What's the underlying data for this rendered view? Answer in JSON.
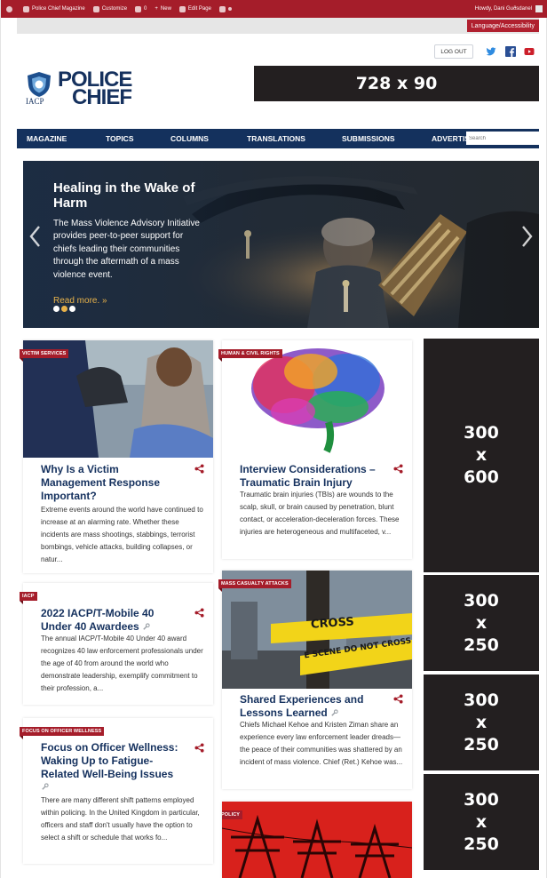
{
  "admin_bar": {
    "site_name": "Police Chief Magazine",
    "customize": "Customize",
    "comments": "0",
    "new": "New",
    "edit_page": "Edit Page",
    "howdy": "Howdy, Dani Guðsdanel"
  },
  "top_bar": {
    "language_label": "Language/Accessibility"
  },
  "header": {
    "logout_label": "LOG OUT",
    "logo_line1": "POLICE",
    "logo_line2": "CHIEF",
    "logo_org": "IACP",
    "leaderboard_ad": "728 x 90"
  },
  "nav": {
    "items": [
      "MAGAZINE",
      "TOPICS",
      "COLUMNS",
      "TRANSLATIONS",
      "SUBMISSIONS",
      "ADVERTIS"
    ],
    "search_placeholder": "Search"
  },
  "slider": {
    "title": "Healing in the Wake of Harm",
    "text": "The Mass Violence Advisory Initiative provides peer-to-peer support for chiefs leading their communities through the aftermath of a mass violence event.",
    "read_more": "Read more. »",
    "dots": 3,
    "active_dot": 1
  },
  "ads": {
    "large": [
      "300",
      "x",
      "600"
    ],
    "medium": [
      "300",
      "x",
      "250"
    ]
  },
  "cards": [
    {
      "tag": "VICTIM SERVICES",
      "title": "Why Is a Victim Management Response Important?",
      "excerpt": "Extreme events around the world have continued to increase at an alarming rate. Whether these incidents are mass shootings, stabbings, terrorist bombings, vehicle attacks, building collapses, or natur..."
    },
    {
      "tag": "HUMAN & CIVIL RIGHTS",
      "title": "Interview Considerations – Traumatic Brain Injury",
      "excerpt": "Traumatic brain injuries (TBIs) are wounds to the scalp, skull, or brain caused by penetration, blunt contact, or acceleration-deceleration forces. These injuries are heterogeneous and multifaceted, v..."
    },
    {
      "tag": "IACP",
      "title": "2022 IACP/T-Mobile 40 Under 40 Awardees",
      "excerpt": "The annual IACP/T-Mobile 40 Under 40 award recognizes 40 law enforcement professionals under the age of 40 from around the world who demonstrate leadership, exemplify commitment to their profession, a..."
    },
    {
      "tag": "MASS CASUALTY ATTACKS",
      "title": "Shared Experiences and Lessons Learned",
      "excerpt": "Chiefs Michael Kehoe and Kristen Ziman share an experience every law enforcement leader dreads—the peace of their communities was shattered by an incident of mass violence. Chief (Ret.) Kehoe was...",
      "tape_text_1": "CROSS",
      "tape_text_2": "E SCENE DO NOT CROSS"
    },
    {
      "tag": "FOCUS ON OFFICER WELLNESS",
      "title": "Focus on Officer Wellness: Waking Up to Fatigue-Related Well-Being Issues",
      "excerpt": "There are many different shift patterns employed within policing. In the United Kingdom in particular, officers and staff don't usually have the option to select a shift or schedule that works fo..."
    },
    {
      "tag": "POLICY"
    }
  ],
  "colors": {
    "navy": "#14315d",
    "red": "#a51d2a",
    "gold": "#e8b24a",
    "ad_bg": "#231f20"
  }
}
